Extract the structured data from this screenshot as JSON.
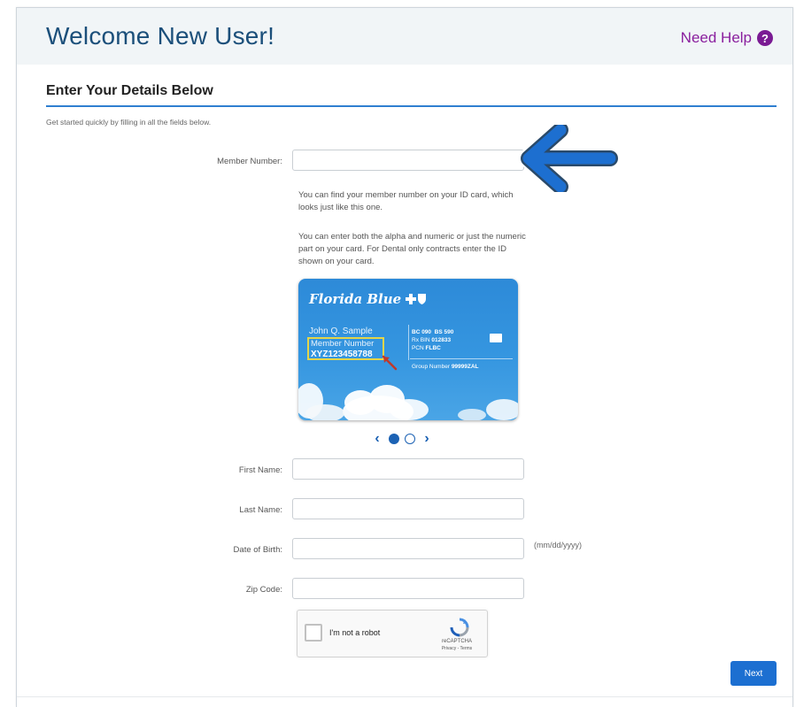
{
  "header": {
    "title": "Welcome New User!",
    "help_label": "Need Help",
    "help_icon": "question-circle-icon"
  },
  "section": {
    "title": "Enter Your Details Below",
    "subtitle": "Get started quickly by filling in all the fields below."
  },
  "form": {
    "member_number": {
      "label": "Member Number:",
      "value": "",
      "placeholder": ""
    },
    "member_help_1": "You can find your member number on your ID card, which looks just like this one.",
    "member_help_2": "You can enter both the alpha and numeric or just the numeric part on your card. For Dental only contracts enter the ID shown on your card.",
    "first_name": {
      "label": "First Name:",
      "value": ""
    },
    "last_name": {
      "label": "Last Name:",
      "value": ""
    },
    "dob": {
      "label": "Date of Birth:",
      "value": "",
      "hint": "(mm/dd/yyyy)"
    },
    "zip": {
      "label": "Zip Code:",
      "value": ""
    }
  },
  "id_card": {
    "brand": "Florida Blue",
    "holder_name": "John Q. Sample",
    "member_number_label": "Member Number",
    "member_number": "XYZ123458788",
    "bc": "BC 090",
    "bs": "BS 590",
    "rx_bin_label": "Rx BIN",
    "rx_bin": "012833",
    "pcn_label": "PCN",
    "pcn": "FLBC",
    "group_label": "Group Number",
    "group": "99999ZAL"
  },
  "carousel": {
    "prev_icon": "chevron-left-icon",
    "next_icon": "chevron-right-icon",
    "active_index": 0,
    "count": 2
  },
  "captcha": {
    "label": "I'm not a robot",
    "brand": "reCAPTCHA",
    "links": "Privacy - Terms"
  },
  "actions": {
    "next_label": "Next"
  },
  "colors": {
    "title": "#1b4f7a",
    "help": "#8a1f9e",
    "accent": "#2f7fd0",
    "button": "#1c6fd1",
    "arrow": "#1d6fd0"
  }
}
